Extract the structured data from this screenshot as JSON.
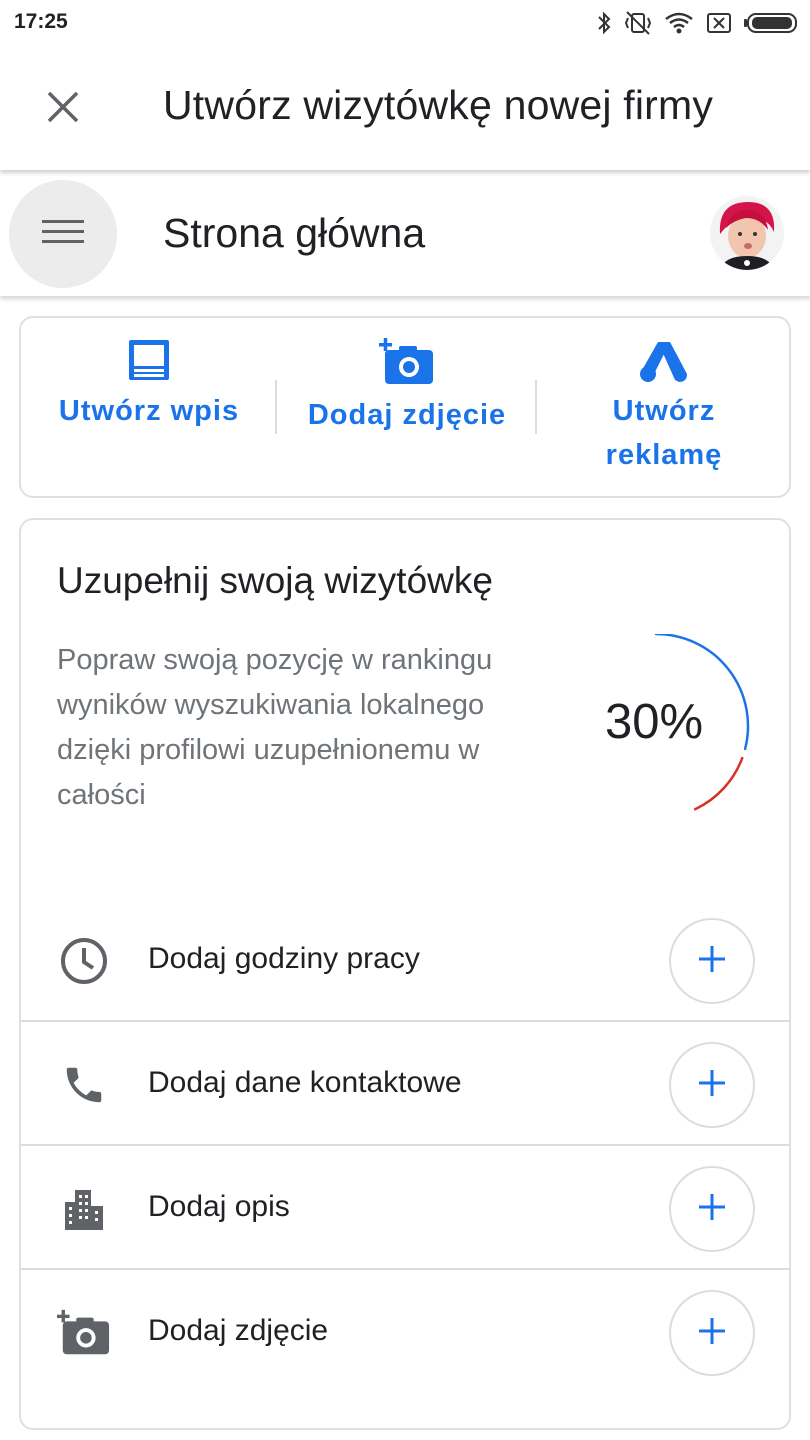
{
  "status_bar": {
    "time": "17:25",
    "icons": [
      "bluetooth-icon",
      "vibrate-off-icon",
      "wifi-icon",
      "sim-off-icon",
      "battery-icon"
    ]
  },
  "header": {
    "close_icon": "close-icon",
    "title": "Utwórz wizytówkę nowej firmy"
  },
  "subheader": {
    "menu_icon": "hamburger-menu-icon",
    "title": "Strona główna",
    "avatar": "user-avatar"
  },
  "quick_actions": [
    {
      "label": "Utwórz wpis",
      "icon": "post-icon"
    },
    {
      "label": "Dodaj zdjęcie",
      "icon": "add-photo-icon"
    },
    {
      "label": "Utwórz reklamę",
      "icon": "google-ads-icon"
    }
  ],
  "completion": {
    "title": "Uzupełnij swoją wizytówkę",
    "description": "Popraw swoją pozycję w rankingu wyników wyszukiwania lokalnego dzięki profilowi uzupełnionemu w całości",
    "progress_text": "30%",
    "progress_value": 0.3,
    "colors": {
      "progress_blue": "#1a73e8",
      "progress_red": "#d93025"
    },
    "tasks": [
      {
        "label": "Dodaj godziny pracy",
        "icon": "clock-icon"
      },
      {
        "label": "Dodaj dane kontaktowe",
        "icon": "phone-icon"
      },
      {
        "label": "Dodaj opis",
        "icon": "building-icon"
      },
      {
        "label": "Dodaj zdjęcie",
        "icon": "add-photo-icon"
      }
    ]
  },
  "theme": {
    "accent": "#1a73e8",
    "text": "#202124",
    "secondary_text": "#6f7479"
  }
}
